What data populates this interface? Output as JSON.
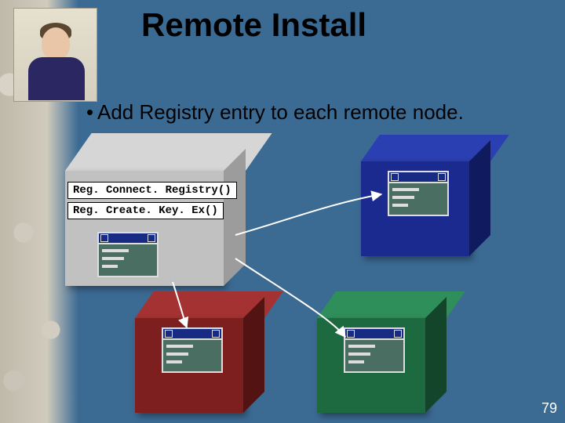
{
  "title": "Remote Install",
  "bullet": "Add Registry entry to each remote node.",
  "code_labels": {
    "connect": "Reg. Connect. Registry()",
    "create": "Reg. Create. Key. Ex()"
  },
  "cubes": {
    "source": "grey",
    "targets": [
      "blue",
      "red",
      "green"
    ]
  },
  "slide_number": "79"
}
